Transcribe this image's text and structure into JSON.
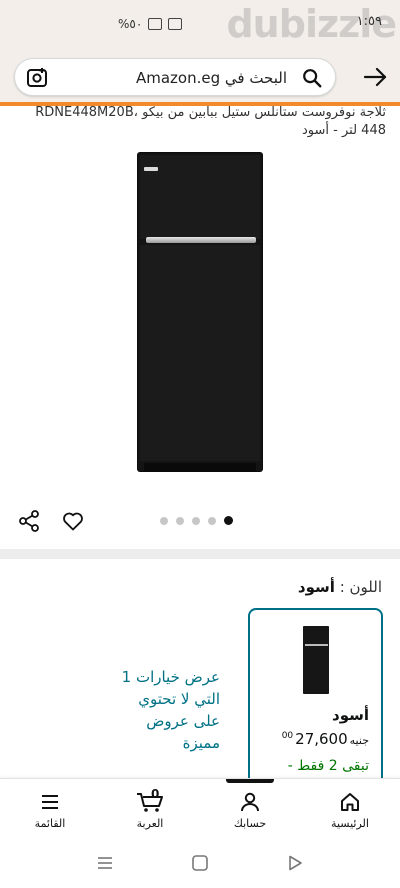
{
  "status_bar": {
    "time": "١:٥٩",
    "battery": "%٥٠",
    "watermark": "dubizzle"
  },
  "search": {
    "placeholder": "البحث في Amazon.eg"
  },
  "product": {
    "title": "ثلاجة نوفروست ستانلس ستيل ببابين من بيكو RDNE448M20B، 448 لتر - أسود",
    "image_count": 5,
    "active_image": 5
  },
  "color_selector": {
    "label": "اللون :",
    "value": "أسود"
  },
  "variant": {
    "name": "أسود",
    "price_whole": "27,600",
    "price_fraction": "00",
    "currency": "جنيه",
    "stock": "تبقى 2 فقط -"
  },
  "other_options": "عرض خيارات 1 التي لا تحتوي على عروض مميزة",
  "bottom_nav": {
    "items": [
      {
        "label": "الرئيسية",
        "icon": "home-icon"
      },
      {
        "label": "حسابك",
        "icon": "account-icon"
      },
      {
        "label": "العربة",
        "icon": "cart-icon",
        "badge": "0"
      },
      {
        "label": "القائمة",
        "icon": "menu-icon"
      }
    ]
  },
  "colors": {
    "accent": "#f08a2a",
    "link": "#007185",
    "stock": "#007600",
    "header_bg": "#f3eee9"
  }
}
